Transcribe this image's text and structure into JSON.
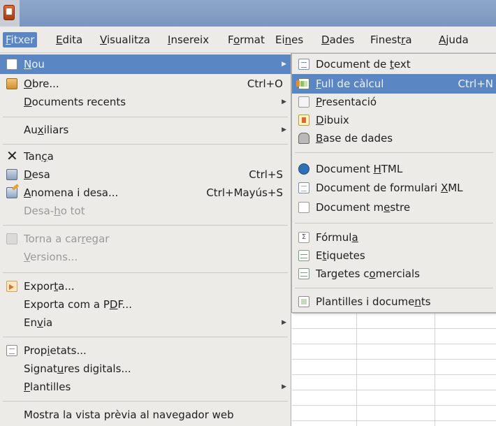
{
  "menubar": [
    {
      "pre": "",
      "key": "F",
      "post": "itxer",
      "active": true
    },
    {
      "pre": "",
      "key": "E",
      "post": "dita",
      "active": false
    },
    {
      "pre": "",
      "key": "V",
      "post": "isualitza",
      "active": false
    },
    {
      "pre": "",
      "key": "I",
      "post": "nsereix",
      "active": false
    },
    {
      "pre": "F",
      "key": "o",
      "post": "rmat",
      "active": false
    },
    {
      "pre": "Ei",
      "key": "n",
      "post": "es",
      "active": false
    },
    {
      "pre": "",
      "key": "D",
      "post": "ades",
      "active": false
    },
    {
      "pre": "Finest",
      "key": "r",
      "post": "a",
      "active": false
    },
    {
      "pre": "",
      "key": "A",
      "post": "juda",
      "active": false
    }
  ],
  "file_menu": [
    {
      "pre": "",
      "key": "N",
      "post": "ou",
      "shortcut": "",
      "submenu": true,
      "icon": "new-document-icon",
      "highlighted": true,
      "disabled": false
    },
    {
      "pre": "",
      "key": "O",
      "post": "bre...",
      "shortcut": "Ctrl+O",
      "submenu": false,
      "icon": "open-folder-icon",
      "highlighted": false,
      "disabled": false
    },
    {
      "pre": "",
      "key": "D",
      "post": "ocuments recents",
      "shortcut": "",
      "submenu": true,
      "icon": "",
      "highlighted": false,
      "disabled": false
    },
    {
      "pre": "Au",
      "key": "x",
      "post": "iliars",
      "shortcut": "",
      "submenu": true,
      "icon": "",
      "highlighted": false,
      "disabled": false
    },
    {
      "pre": "Tan",
      "key": "c",
      "post": "a",
      "shortcut": "",
      "submenu": false,
      "icon": "close-icon",
      "highlighted": false,
      "disabled": false,
      "display": "Tança"
    },
    {
      "pre": "",
      "key": "D",
      "post": "esa",
      "shortcut": "Ctrl+S",
      "submenu": false,
      "icon": "save-icon",
      "highlighted": false,
      "disabled": false
    },
    {
      "pre": "",
      "key": "A",
      "post": "nomena i desa...",
      "shortcut": "Ctrl+Mayús+S",
      "submenu": false,
      "icon": "save-as-icon",
      "highlighted": false,
      "disabled": false
    },
    {
      "pre": "Desa-",
      "key": "h",
      "post": "o tot",
      "shortcut": "",
      "submenu": false,
      "icon": "",
      "highlighted": false,
      "disabled": true
    },
    {
      "pre": "Torna a car",
      "key": "r",
      "post": "egar",
      "shortcut": "",
      "submenu": false,
      "icon": "reload-icon",
      "highlighted": false,
      "disabled": true
    },
    {
      "pre": "",
      "key": "V",
      "post": "ersions...",
      "shortcut": "",
      "submenu": false,
      "icon": "",
      "highlighted": false,
      "disabled": true
    },
    {
      "pre": "Expor",
      "key": "t",
      "post": "a...",
      "shortcut": "",
      "submenu": false,
      "icon": "export-icon",
      "highlighted": false,
      "disabled": false
    },
    {
      "pre": "Exporta com a P",
      "key": "D",
      "post": "F...",
      "shortcut": "",
      "submenu": false,
      "icon": "",
      "highlighted": false,
      "disabled": false
    },
    {
      "pre": "En",
      "key": "v",
      "post": "ia",
      "shortcut": "",
      "submenu": true,
      "icon": "",
      "highlighted": false,
      "disabled": false
    },
    {
      "pre": "Prop",
      "key": "i",
      "post": "etats...",
      "shortcut": "",
      "submenu": false,
      "icon": "properties-icon",
      "highlighted": false,
      "disabled": false
    },
    {
      "pre": "Signat",
      "key": "u",
      "post": "res digitals...",
      "shortcut": "",
      "submenu": false,
      "icon": "",
      "highlighted": false,
      "disabled": false
    },
    {
      "pre": "",
      "key": "P",
      "post": "lantilles",
      "shortcut": "",
      "submenu": true,
      "icon": "",
      "highlighted": false,
      "disabled": false
    },
    {
      "pre": "Mostra la vista prèvia al navegador web",
      "key": "",
      "post": "",
      "shortcut": "",
      "submenu": false,
      "icon": "",
      "highlighted": false,
      "disabled": false
    }
  ],
  "new_submenu": [
    {
      "pre": "Document de ",
      "key": "t",
      "post": "ext",
      "shortcut": "",
      "icon": "text-document-icon",
      "highlighted": false
    },
    {
      "pre": "",
      "key": "F",
      "post": "ull de càlcul",
      "shortcut": "Ctrl+N",
      "icon": "spreadsheet-icon",
      "highlighted": true
    },
    {
      "pre": "",
      "key": "P",
      "post": "resentació",
      "shortcut": "",
      "icon": "presentation-icon",
      "highlighted": false
    },
    {
      "pre": "",
      "key": "D",
      "post": "ibuix",
      "shortcut": "",
      "icon": "drawing-icon",
      "highlighted": false
    },
    {
      "pre": "",
      "key": "B",
      "post": "ase de dades",
      "shortcut": "",
      "icon": "database-icon",
      "highlighted": false
    },
    {
      "pre": "Document ",
      "key": "H",
      "post": "TML",
      "shortcut": "",
      "icon": "html-document-icon",
      "highlighted": false
    },
    {
      "pre": "Document de formulari ",
      "key": "X",
      "post": "ML",
      "shortcut": "",
      "icon": "xml-form-icon",
      "highlighted": false
    },
    {
      "pre": "Document m",
      "key": "e",
      "post": "stre",
      "shortcut": "",
      "icon": "master-document-icon",
      "highlighted": false
    },
    {
      "pre": "Fórmul",
      "key": "a",
      "post": "",
      "shortcut": "",
      "icon": "formula-icon",
      "highlighted": false
    },
    {
      "pre": "E",
      "key": "t",
      "post": "iquetes",
      "shortcut": "",
      "icon": "labels-icon",
      "highlighted": false
    },
    {
      "pre": "Targetes c",
      "key": "o",
      "post": "mercials",
      "shortcut": "",
      "icon": "business-cards-icon",
      "highlighted": false
    },
    {
      "pre": "Plantilles i docume",
      "key": "n",
      "post": "ts",
      "shortcut": "",
      "icon": "templates-icon",
      "highlighted": false
    }
  ],
  "colors": {
    "highlight": "#5b86c4",
    "menu_bg": "#ecebe8",
    "titlebar": "#8ea6c9"
  }
}
